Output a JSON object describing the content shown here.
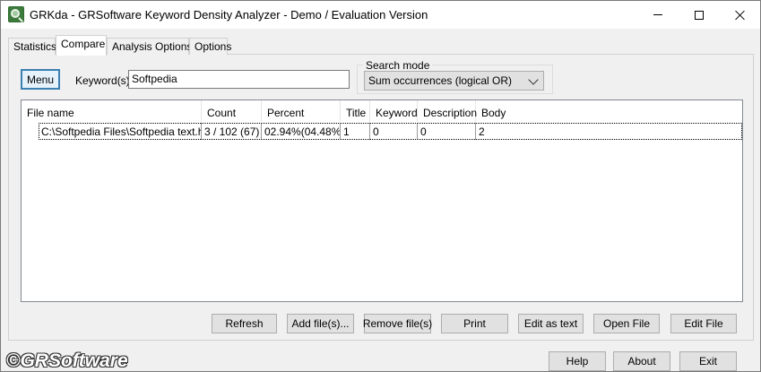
{
  "window": {
    "title": "GRKda - GRSoftware Keyword Density Analyzer - Demo / Evaluation Version",
    "icon": "magnifier-icon"
  },
  "tabs": [
    {
      "label": "Statistics",
      "active": false
    },
    {
      "label": "Compare",
      "active": true
    },
    {
      "label": "Analysis Options",
      "active": false
    },
    {
      "label": "Options",
      "active": false
    }
  ],
  "controls": {
    "menu_label": "Menu",
    "keyword_label": "Keyword(s):",
    "keyword_value": "Softpedia",
    "search_mode_legend": "Search mode",
    "search_mode_value": "Sum occurrences (logical OR)"
  },
  "list": {
    "columns": [
      "File name",
      "Count",
      "Percent",
      "Title",
      "Keyword",
      "Description",
      "Body"
    ],
    "rows": [
      [
        "C:\\Softpedia Files\\Softpedia text.html",
        "3 / 102 (67)",
        "02.94%(04.48%)",
        "1",
        "0",
        "0",
        "2"
      ]
    ]
  },
  "buttons": {
    "refresh": "Refresh",
    "add_files": "Add file(s)...",
    "remove_files": "Remove file(s)",
    "print": "Print",
    "edit_as_text": "Edit as text",
    "open_file": "Open File",
    "edit_file": "Edit File",
    "help": "Help",
    "about": "About",
    "exit": "Exit"
  },
  "brand": "©GRSoftware"
}
